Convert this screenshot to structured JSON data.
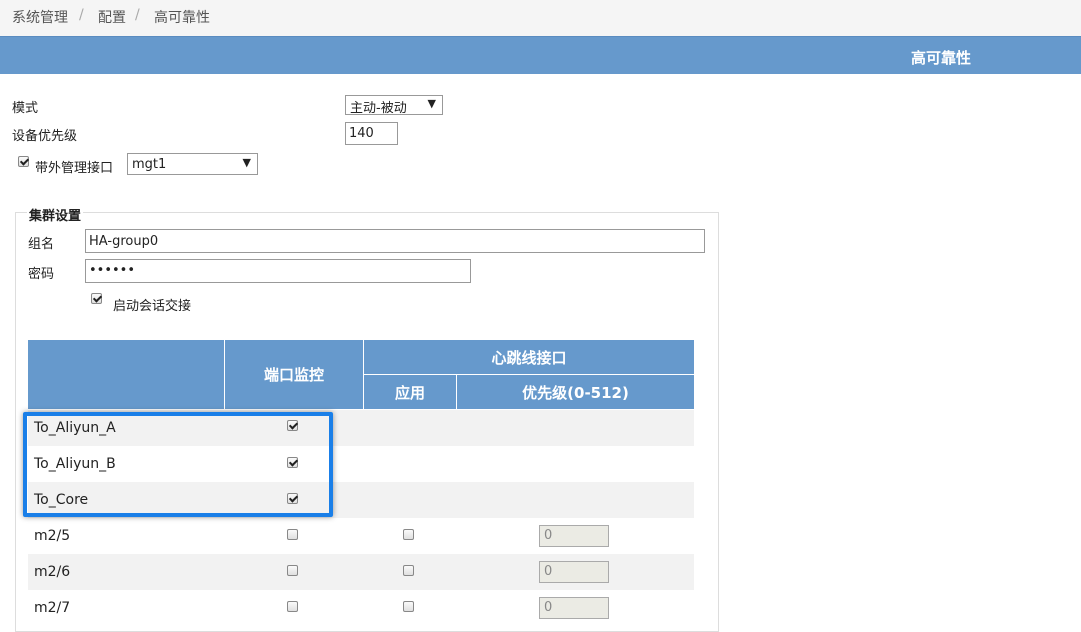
{
  "breadcrumb": {
    "items": [
      "系统管理",
      "配置",
      "高可靠性"
    ],
    "separator": "/"
  },
  "header": {
    "title": "高可靠性"
  },
  "mode": {
    "label": "模式",
    "value": "主动-被动"
  },
  "priority": {
    "label": "设备优先级",
    "value": "140"
  },
  "oob": {
    "label": "带外管理接口",
    "checked": true,
    "value": "mgt1"
  },
  "cluster": {
    "legend": "集群设置",
    "group_label": "组名",
    "group_value": "HA-group0",
    "password_label": "密码",
    "password_value": "••••••",
    "session_label": "启动会话交接",
    "session_checked": true
  },
  "table": {
    "col_monitor": "端口监控",
    "col_heartbeat": "心跳线接口",
    "col_apply": "应用",
    "col_priority": "优先级(0-512)",
    "rows": [
      {
        "name": "To_Aliyun_A",
        "monitor": true
      },
      {
        "name": "To_Aliyun_B",
        "monitor": true
      },
      {
        "name": "To_Core",
        "monitor": true
      },
      {
        "name": "m2/5",
        "monitor": false,
        "apply": false,
        "priority": "0"
      },
      {
        "name": "m2/6",
        "monitor": false,
        "apply": false,
        "priority": "0"
      },
      {
        "name": "m2/7",
        "monitor": false,
        "apply": false,
        "priority": "0"
      }
    ]
  },
  "colors": {
    "header_blue": "#6699cc",
    "highlight_blue": "#1a7fe8"
  }
}
